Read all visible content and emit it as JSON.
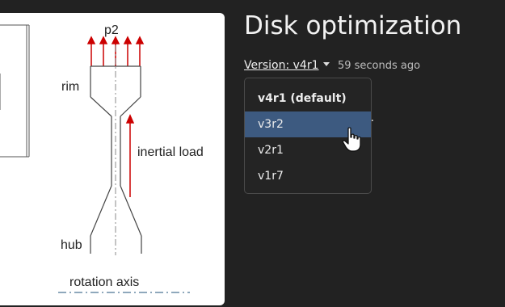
{
  "page": {
    "title": "Disk optimization",
    "version_label": "Version: v4r1",
    "updated": "59 seconds ago",
    "obscured_text_end": "e."
  },
  "version_menu": {
    "items": [
      {
        "label": "v4r1 (default)",
        "state": "default"
      },
      {
        "label": "v3r2",
        "state": "hovered"
      },
      {
        "label": "v2r1",
        "state": "normal"
      },
      {
        "label": "v1r7",
        "state": "normal"
      }
    ]
  },
  "figure": {
    "top_label": "p2",
    "rim_label": "rim",
    "load_label": "inertial load",
    "hub_label": "hub",
    "axis_label": "rotation axis",
    "load_arrow_color": "#cc0000"
  },
  "colors": {
    "background": "#222222",
    "menu_active": "#3d5a80"
  },
  "icons": [
    "caret-down-icon",
    "hand-pointer-cursor"
  ]
}
